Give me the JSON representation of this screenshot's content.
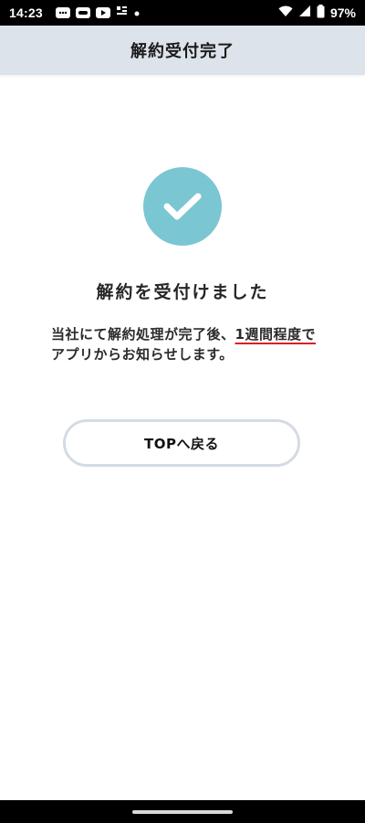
{
  "status_bar": {
    "time": "14:23",
    "battery": "97%"
  },
  "header": {
    "title": "解約受付完了"
  },
  "content": {
    "success_title": "解約を受付けました",
    "message_before": "当社にて解約処理が完了後、",
    "message_highlight": "1週間程度で",
    "message_after": "アプリからお知らせします。"
  },
  "actions": {
    "top_button_label": "TOPへ戻る"
  },
  "colors": {
    "header_bg": "#dde3ea",
    "check_circle": "#7bc6d3",
    "highlight_underline": "#d62222",
    "button_border": "#d4dbe4"
  },
  "icons": {
    "check": "check-icon"
  }
}
